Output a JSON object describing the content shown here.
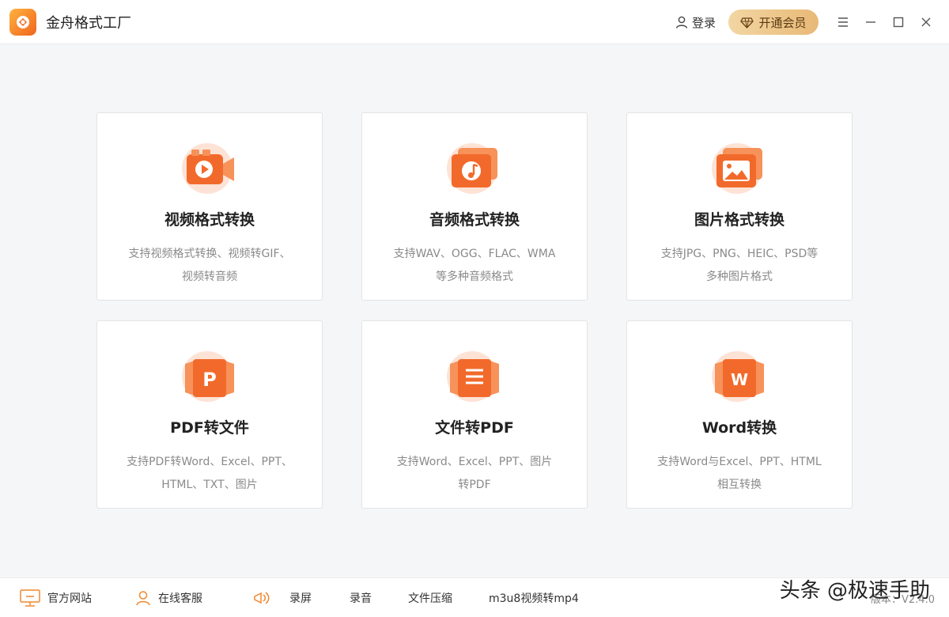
{
  "app": {
    "title": "金舟格式工厂",
    "accent": "#f26a2b"
  },
  "header": {
    "login_label": "登录",
    "vip_label": "开通会员"
  },
  "cards": [
    {
      "title": "视频格式转换",
      "desc_line1": "支持视频格式转换、视频转GIF、",
      "desc_line2": "视频转音频",
      "icon": "video-camera-icon"
    },
    {
      "title": "音频格式转换",
      "desc_line1": "支持WAV、OGG、FLAC、WMA",
      "desc_line2": "等多种音频格式",
      "icon": "music-note-icon"
    },
    {
      "title": "图片格式转换",
      "desc_line1": "支持JPG、PNG、HEIC、PSD等",
      "desc_line2": "多种图片格式",
      "icon": "image-icon"
    },
    {
      "title": "PDF转文件",
      "desc_line1": "支持PDF转Word、Excel、PPT、",
      "desc_line2": "HTML、TXT、图片",
      "icon": "pdf-p-icon",
      "glyph": "P"
    },
    {
      "title": "文件转PDF",
      "desc_line1": "支持Word、Excel、PPT、图片",
      "desc_line2": "转PDF",
      "icon": "document-lines-icon"
    },
    {
      "title": "Word转换",
      "desc_line1": "支持Word与Excel、PPT、HTML",
      "desc_line2": "相互转换",
      "icon": "word-w-icon",
      "glyph": "W"
    }
  ],
  "footer": {
    "website": "官方网站",
    "support": "在线客服",
    "record_screen": "录屏",
    "record_audio": "录音",
    "compress": "文件压缩",
    "m3u8": "m3u8视频转mp4",
    "version": "版本：V2.4.0"
  },
  "watermark": "头条 @极速手助"
}
